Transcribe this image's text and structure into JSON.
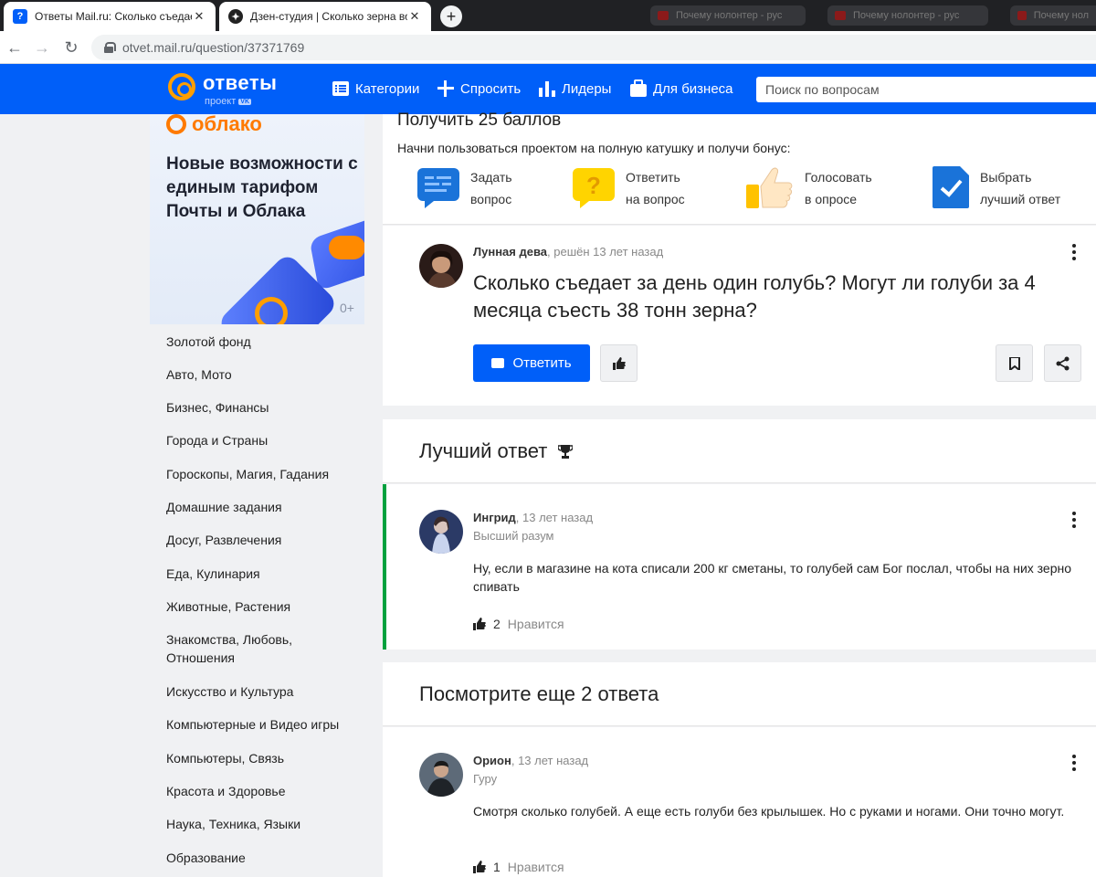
{
  "browser": {
    "tabs": [
      {
        "title": "Ответы Mail.ru: Сколько съедает",
        "active": true
      },
      {
        "title": "Дзен-студия | Сколько зерна во",
        "active": false
      }
    ],
    "background_tabs": [
      "Почему нолонтер - рус",
      "Почему нолонтер - рус",
      "Почему нол"
    ],
    "url": "otvet.mail.ru/question/37371769"
  },
  "header": {
    "logo_word": "ответы",
    "logo_sub": "проект",
    "logo_badge": "VK",
    "nav": [
      {
        "label": "Категории",
        "icon": "list-icon"
      },
      {
        "label": "Спросить",
        "icon": "plus-icon"
      },
      {
        "label": "Лидеры",
        "icon": "bar-chart-icon"
      },
      {
        "label": "Для бизнеса",
        "icon": "briefcase-icon"
      }
    ],
    "search_placeholder": "Поиск по вопросам"
  },
  "ad": {
    "brand": "облако",
    "headline": "Новые возможности с единым тарифом Почты и Облака",
    "age": "0+"
  },
  "categories": [
    "Золотой фонд",
    "Авто, Мото",
    "Бизнес, Финансы",
    "Города и Страны",
    "Гороскопы, Магия, Гадания",
    "Домашние задания",
    "Досуг, Развлечения",
    "Еда, Кулинария",
    "Животные, Растения",
    "Знакомства, Любовь, Отношения",
    "Искусство и Культура",
    "Компьютерные и Видео игры",
    "Компьютеры, Связь",
    "Красота и Здоровье",
    "Наука, Техника, Языки",
    "Образование"
  ],
  "bonus": {
    "title": "Получить 25 баллов",
    "desc": "Начни пользоваться проектом на полную катушку и получи бонус:",
    "features": [
      {
        "line1": "Задать",
        "line2": "вопрос",
        "icon": "ask-icon"
      },
      {
        "line1": "Ответить",
        "line2": "на вопрос",
        "icon": "question-mark-icon"
      },
      {
        "line1": "Голосовать",
        "line2": "в опросе",
        "icon": "thumbs-up-hand-icon"
      },
      {
        "line1": "Выбрать",
        "line2": "лучший ответ",
        "icon": "checkmark-doc-icon"
      }
    ]
  },
  "question": {
    "author": "Лунная дева",
    "status": ", решён 13 лет назад",
    "title": "Сколько съедает за день один голубь? Могут ли голуби за 4 месяца съесть 38 тонн зерна?",
    "answer_button": "Ответить"
  },
  "best": {
    "heading": "Лучший ответ",
    "author": "Ингрид",
    "time": ", 13 лет назад",
    "rank": "Высший разум",
    "text": "Ну, если в магазине на кота списали 200 кг сметаны, то голубей сам Бог послал, чтобы на них зерно спивать",
    "likes": "2",
    "likes_label": "Нравится"
  },
  "more": {
    "heading": "Посмотрите еще 2 ответа",
    "author": "Орион",
    "time": ", 13 лет назад",
    "rank": "Гуру",
    "text": "Смотря сколько голубей. А еще есть голуби без крылышек. Но с руками и ногами. Они точно могут.",
    "likes": "1",
    "likes_label": "Нравится"
  },
  "colors": {
    "brand_blue": "#005ff9",
    "accent_orange": "#ff9e00",
    "best_green": "#00a13e"
  }
}
